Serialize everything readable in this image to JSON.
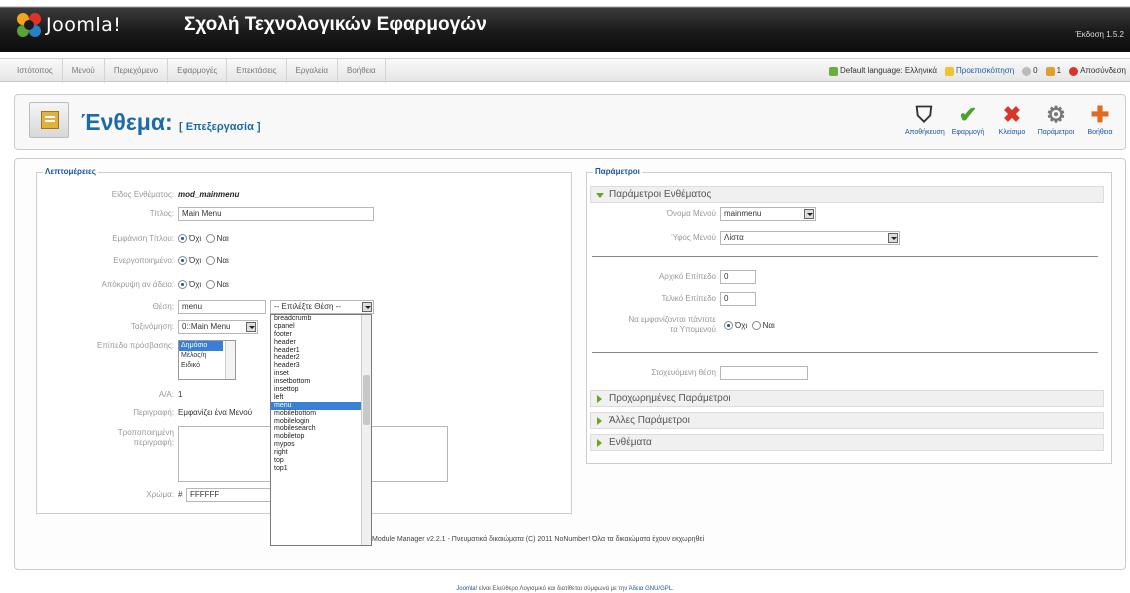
{
  "header": {
    "brand": "Joomla!",
    "site_name": "Σχολή Τεχνολογικών Εφαρμογών",
    "version": "Έκδοση 1.5.2"
  },
  "menu": {
    "items": [
      "Ιστότοπος",
      "Μενού",
      "Περιεχόμενο",
      "Εφαρμογές",
      "Επεκτάσεις",
      "Εργαλεία",
      "Βοήθεια"
    ]
  },
  "status": {
    "language": "Default language: Ελληνικά",
    "preview": "Προεπισκόπηση",
    "messages": "0",
    "users": "1",
    "logout": "Αποσύνδεση"
  },
  "toolbar": {
    "title": "Ένθεμα:",
    "subtitle": "[ Επεξεργασία ]",
    "buttons": [
      {
        "name": "save",
        "label": "Αποθήκευση",
        "glyph": "⛉",
        "color": "#333333"
      },
      {
        "name": "apply",
        "label": "Εφαρμογή",
        "glyph": "✔",
        "color": "#4aa12f"
      },
      {
        "name": "close",
        "label": "Κλείσιμο",
        "glyph": "✖",
        "color": "#d8362a"
      },
      {
        "name": "params",
        "label": "Παράμετροι",
        "glyph": "⚙",
        "color": "#777777"
      },
      {
        "name": "help",
        "label": "Βοήθεια",
        "glyph": "✚",
        "color": "#e06a1e"
      }
    ]
  },
  "details": {
    "legend": "Λεπτομέρειες",
    "type_label": "Είδος Ενθέματος:",
    "type_value": "mod_mainmenu",
    "title_label": "Τίτλος:",
    "title_value": "Main Menu",
    "show_title_label": "Εμφάνιση Τίτλου:",
    "enabled_label": "Ενεργοποιημένο:",
    "hide_empty_label": "Απόκρυψη αν άδειο:",
    "no": "Όχι",
    "yes": "Ναι",
    "position_label": "Θέση:",
    "position_value": "menu",
    "position_select": "-- Επιλέξτε Θέση --",
    "order_label": "Ταξινόμηση:",
    "order_value": "0::Main Menu",
    "access_label": "Επίπεδο πρόσβασης:",
    "access_options": [
      "Δημόσιο",
      "Μέλος/η",
      "Ειδικό"
    ],
    "id_label": "Α/Α:",
    "id_value": "1",
    "desc_label": "Περιγραφή:",
    "desc_value": "Εμφανίζει ένα Μενού",
    "custom_desc_label_1": "Τροποποιημένη",
    "custom_desc_label_2": "περιγραφή:",
    "color_label": "Χρώμα:",
    "color_hash": "#",
    "color_value": "FFFFFF"
  },
  "position_list": [
    "breadcrumb",
    "cpanel",
    "footer",
    "header",
    "header1",
    "header2",
    "header3",
    "inset",
    "insetbottom",
    "insettop",
    "left",
    "menu",
    "mobilebottom",
    "mobilelogin",
    "mobilesearch",
    "mobiletop",
    "mypos",
    "right",
    "top",
    "top1"
  ],
  "position_selected_index": 11,
  "params": {
    "legend": "Παράμετροι",
    "module_params": "Παράμετροι Ενθέματος",
    "menu_name_label": "Όνομα Μενού",
    "menu_name_value": "mainmenu",
    "menu_style_label": "Ύφος Μενού",
    "menu_style_value": "Λίστα",
    "start_level_label": "Αρχικό Επίπεδο",
    "start_level_value": "0",
    "end_level_label": "Τελικό Επίπεδο",
    "end_level_value": "0",
    "show_sub_label_1": "Να εμφανίζονται πάντοτε",
    "show_sub_label_2": "τα Υπομενού",
    "target_label": "Στοχευόμενη θέση",
    "advanced": "Προχωρημένες Παράμετροι",
    "other": "Άλλες Παράμετροι",
    "modules": "Ενθέματα"
  },
  "copyright": "Module Manager v2.2.1 - Πνευματικά δικαιώματα (C) 2011 NoNumber! Όλα τα δικαιώματα έχουν εκχωρηθεί",
  "footer": {
    "joomla": "Joomla!",
    "text": " είναι Ελεύθερο Λογισμικό και διατίθεται σύμφωνα με την ",
    "license": "Άδεια GNU/GPL."
  }
}
